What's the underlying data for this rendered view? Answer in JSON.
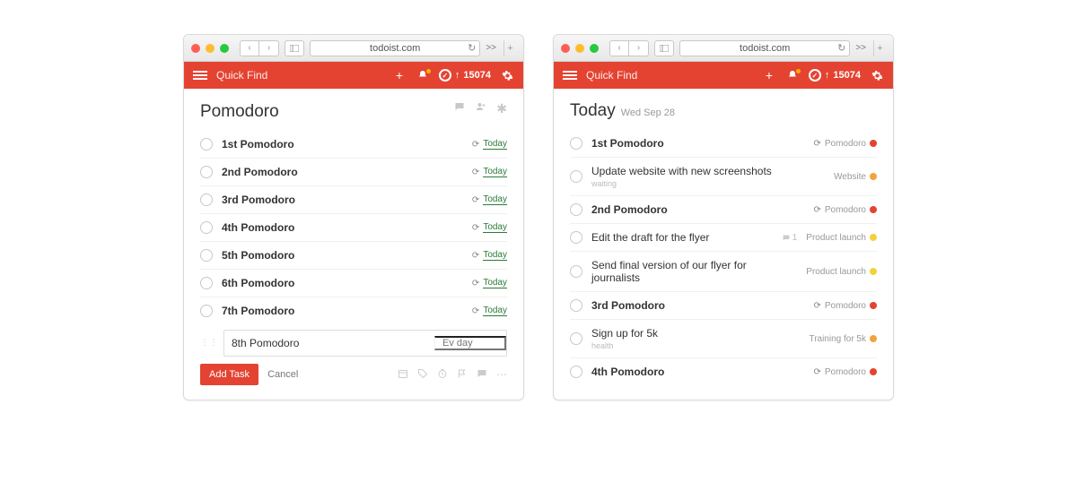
{
  "chrome": {
    "url": "todoist.com",
    "overflow": ">>"
  },
  "header": {
    "search_placeholder": "Quick Find",
    "karma_score": "15074",
    "karma_arrow": "↑"
  },
  "left": {
    "title": "Pomodoro",
    "tasks": [
      {
        "title": "1st Pomodoro",
        "due": "Today"
      },
      {
        "title": "2nd Pomodoro",
        "due": "Today"
      },
      {
        "title": "3rd Pomodoro",
        "due": "Today"
      },
      {
        "title": "4th Pomodoro",
        "due": "Today"
      },
      {
        "title": "5th Pomodoro",
        "due": "Today"
      },
      {
        "title": "6th Pomodoro",
        "due": "Today"
      },
      {
        "title": "7th Pomodoro",
        "due": "Today"
      }
    ],
    "editor": {
      "value": "8th Pomodoro",
      "date_placeholder": "Ev day",
      "add_label": "Add Task",
      "cancel_label": "Cancel"
    }
  },
  "right": {
    "title": "Today",
    "subtitle": "Wed Sep 28",
    "tasks": [
      {
        "title": "1st Pomodoro",
        "bold": true,
        "repeat": true,
        "project": "Pomodoro",
        "color": "#e44332"
      },
      {
        "title": "Update website with new screenshots",
        "sub": "waiting",
        "project": "Website",
        "color": "#f2a33a"
      },
      {
        "title": "2nd Pomodoro",
        "bold": true,
        "repeat": true,
        "project": "Pomodoro",
        "color": "#e44332"
      },
      {
        "title": "Edit the draft for the flyer",
        "comment": "1",
        "project": "Product launch",
        "color": "#f2d23a"
      },
      {
        "title": "Send final version of our flyer for journalists",
        "project": "Product launch",
        "color": "#f2d23a"
      },
      {
        "title": "3rd Pomodoro",
        "bold": true,
        "repeat": true,
        "project": "Pomodoro",
        "color": "#e44332"
      },
      {
        "title": "Sign up for 5k",
        "sub": "health",
        "project": "Training for 5k",
        "color": "#f2a33a"
      },
      {
        "title": "4th Pomodoro",
        "bold": true,
        "repeat": true,
        "project": "Pomodoro",
        "color": "#e44332"
      }
    ]
  }
}
